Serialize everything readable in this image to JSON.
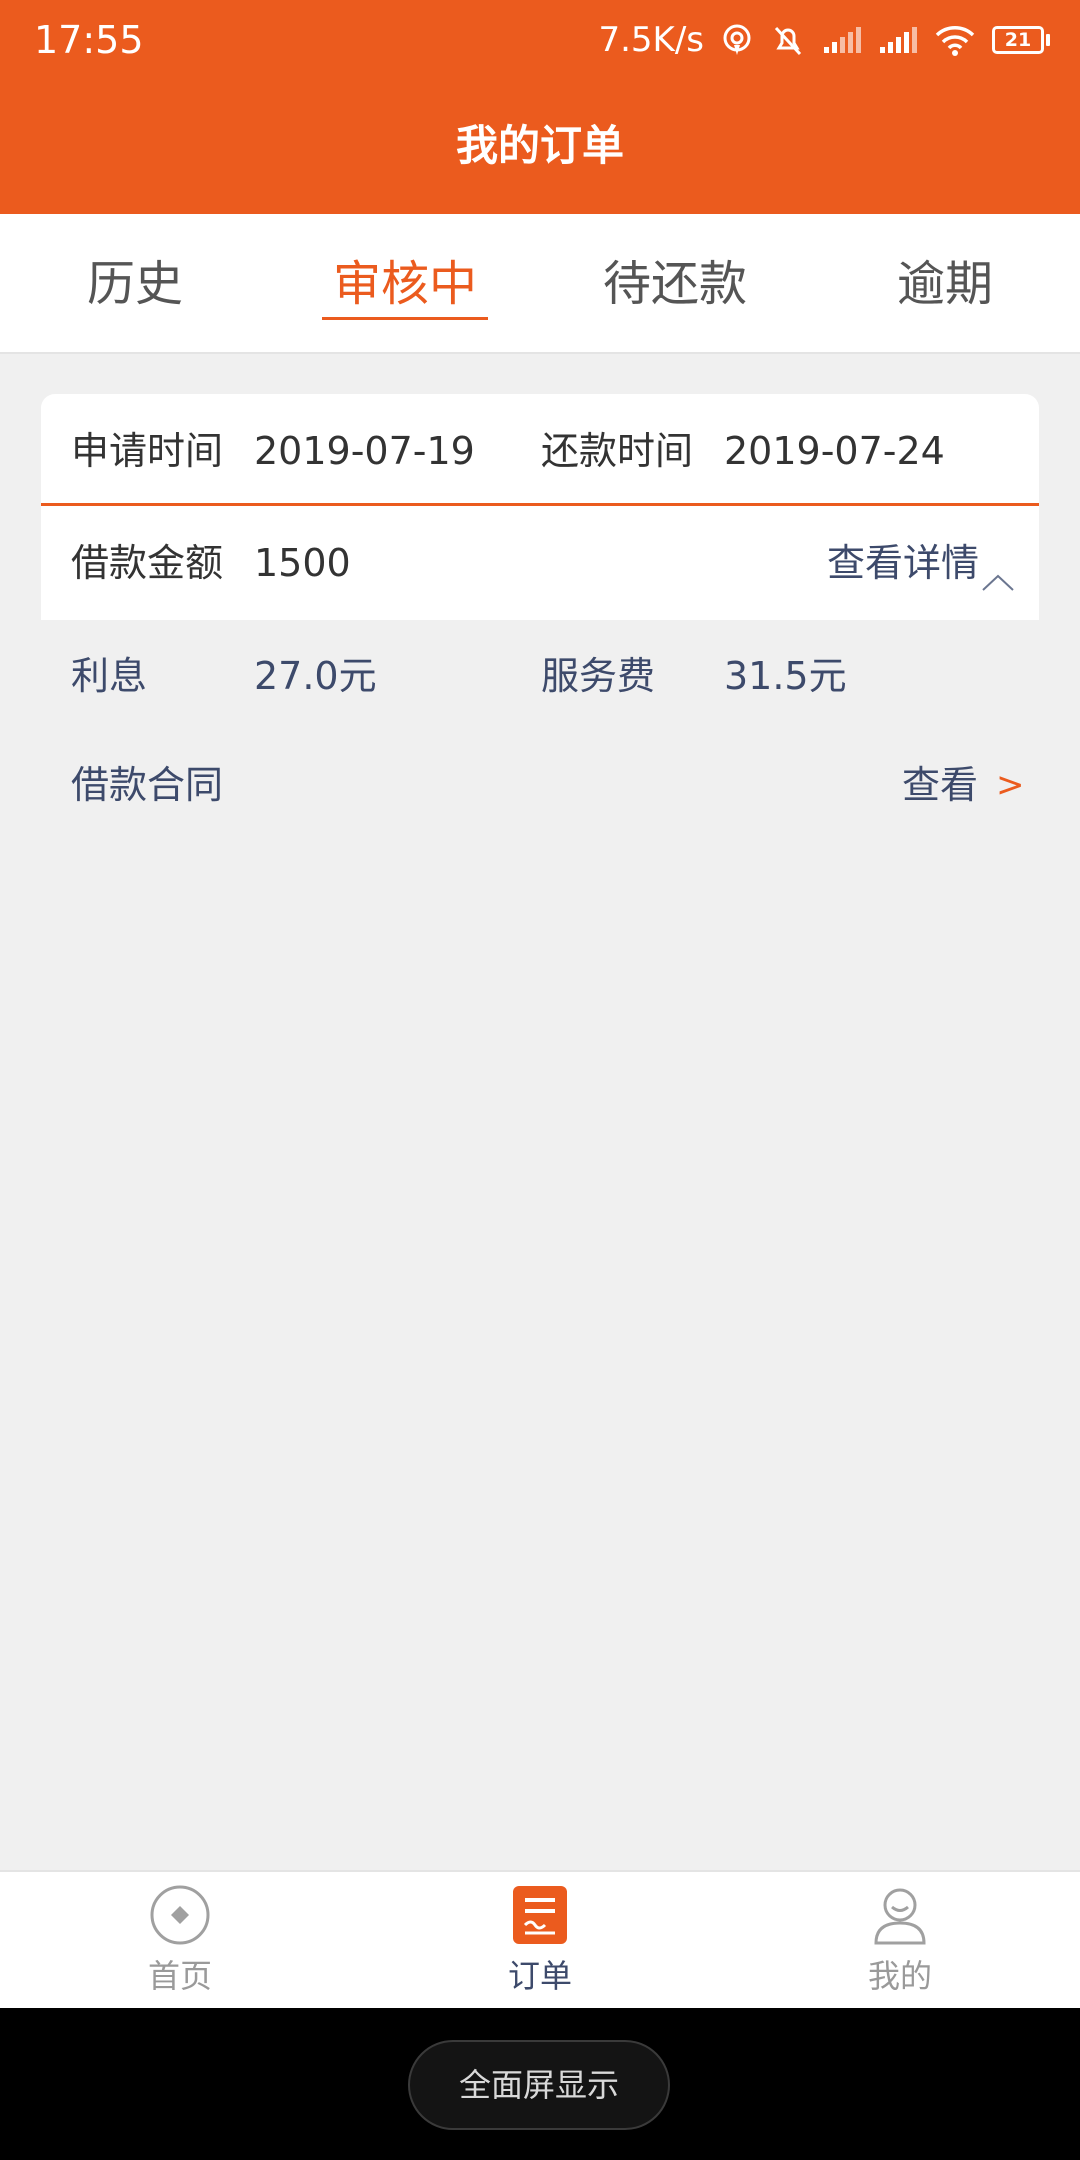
{
  "status_bar": {
    "time": "17:55",
    "net_speed": "7.5K/s",
    "battery_level": "21",
    "icons": [
      "hotspot-icon",
      "mute-icon",
      "signal-icon",
      "signal-icon",
      "wifi-icon",
      "battery-icon"
    ]
  },
  "header": {
    "title": "我的订单"
  },
  "tabs": [
    {
      "label": "历史",
      "active": false
    },
    {
      "label": "审核中",
      "active": true
    },
    {
      "label": "待还款",
      "active": false
    },
    {
      "label": "逾期",
      "active": false
    }
  ],
  "order": {
    "apply_time_label": "申请时间",
    "apply_time": "2019-07-19",
    "repay_time_label": "还款时间",
    "repay_time": "2019-07-24",
    "amount_label": "借款金额",
    "amount": "1500",
    "detail_link": "查看详情",
    "interest_label": "利息",
    "interest": "27.0元",
    "service_fee_label": "服务费",
    "service_fee": "31.5元",
    "contract_label": "借款合同",
    "contract_link": "查看",
    "contract_arrow": ">"
  },
  "bottom_nav": [
    {
      "label": "首页",
      "icon": "home-icon",
      "active": false
    },
    {
      "label": "订单",
      "icon": "order-icon",
      "active": true
    },
    {
      "label": "我的",
      "icon": "profile-icon",
      "active": false
    }
  ],
  "system": {
    "fullscreen_button": "全面屏显示"
  },
  "colors": {
    "accent": "#eb5b1e",
    "text_blue": "#3d4a6b",
    "background": "#f0f0f0"
  }
}
